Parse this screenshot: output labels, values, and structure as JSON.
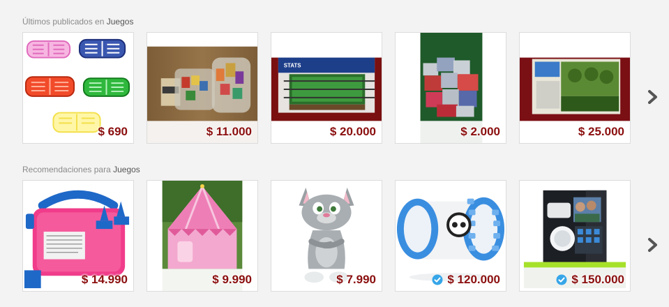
{
  "sections": [
    {
      "title_prefix": "Últimos publicados en",
      "category": "Juegos",
      "items": [
        {
          "price": "$ 690",
          "verified": false,
          "icon": "shutter-glasses-image"
        },
        {
          "price": "$ 11.000",
          "verified": false,
          "icon": "letter-blocks-image"
        },
        {
          "price": "$ 20.000",
          "verified": false,
          "icon": "foosball-table-image"
        },
        {
          "price": "$ 2.000",
          "verified": false,
          "icon": "toy-bags-image"
        },
        {
          "price": "$ 25.000",
          "verified": false,
          "icon": "ninja-turtles-box-image"
        }
      ]
    },
    {
      "title_prefix": "Recomendaciones para",
      "category": "Juegos",
      "items": [
        {
          "price": "$ 14.990",
          "verified": false,
          "icon": "balloon-pump-image"
        },
        {
          "price": "$ 9.990",
          "verified": false,
          "icon": "pink-tent-image"
        },
        {
          "price": "$ 7.990",
          "verified": false,
          "icon": "talking-tom-image"
        },
        {
          "price": "$ 120.000",
          "verified": true,
          "icon": "sphero-robot-image"
        },
        {
          "price": "$ 150.000",
          "verified": true,
          "icon": "sphero-box-image"
        }
      ]
    }
  ],
  "next_icon": "chevron-right-icon",
  "verified_icon": "verified-check-icon",
  "colors": {
    "price": "#8b0f0f",
    "verified": "#36a6e8",
    "background": "#f3f3f3"
  }
}
